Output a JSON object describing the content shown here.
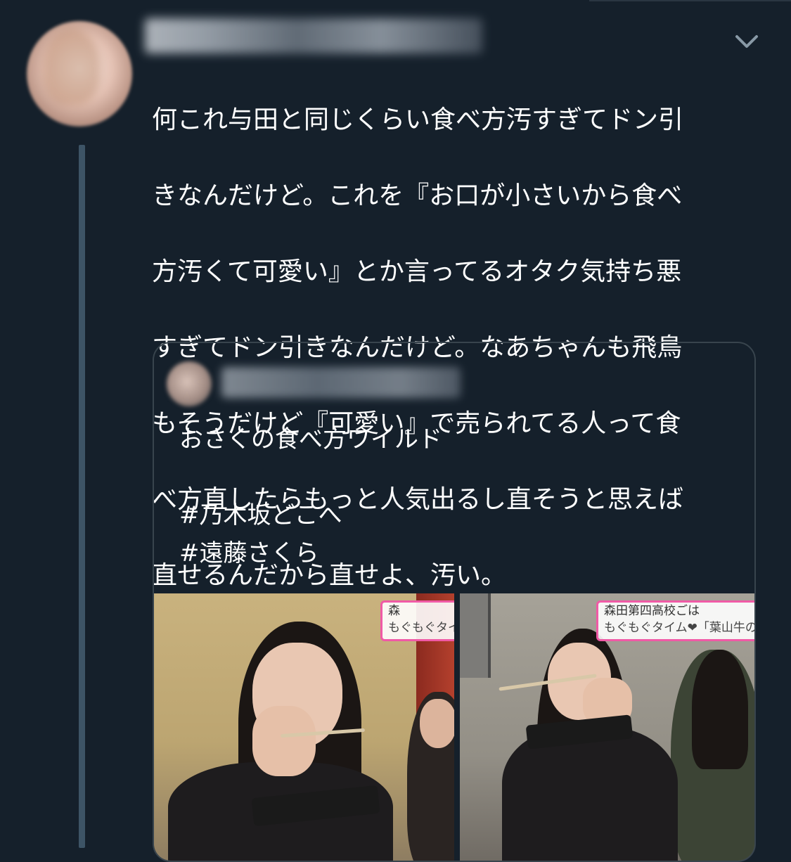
{
  "tweet": {
    "text": "何これ与田と同じくらい食べ方汚すぎてドン引きなんだけど。これを『お口が小さいから食べ方汚くて可愛い』とか言ってるオタク気持ち悪すぎてドン引きなんだけど。なあちゃんも飛鳥もそうだけど『可愛い』で売られてる人って食べ方直したらもっと人気出るし直そうと思えば直せるんだから直せよ、汚い。",
    "lines": [
      "何これ与田と同じくらい食べ方汚すぎてドン引",
      "きなんだけど。これを『お口が小さいから食べ",
      "方汚くて可愛い』とか言ってるオタク気持ち悪",
      "すぎてドン引きなんだけど。なあちゃんも飛鳥",
      "もそうだけど『可愛い』で売られてる人って食",
      "べ方直したらもっと人気出るし直そうと思えば",
      "直せるんだから直せよ、汚い。"
    ]
  },
  "quoted_tweet": {
    "text_line": "おさくの食べ方ワイルド",
    "hashtags": [
      "#乃木坂どこへ",
      "#遠藤さくら"
    ]
  },
  "media": [
    {
      "caption_line1": "森",
      "caption_line2": "もぐもぐタイ"
    },
    {
      "caption_line1": "森田第四高校ごは",
      "caption_line2": "もぐもぐタイム❤「葉山牛の"
    }
  ],
  "colors": {
    "background": "#15202b",
    "text": "#ffffff",
    "border": "#38444d",
    "thread_line": "#3d5466",
    "caption_border": "#f05aa6"
  },
  "icons": {
    "menu": "chevron-down-icon"
  }
}
